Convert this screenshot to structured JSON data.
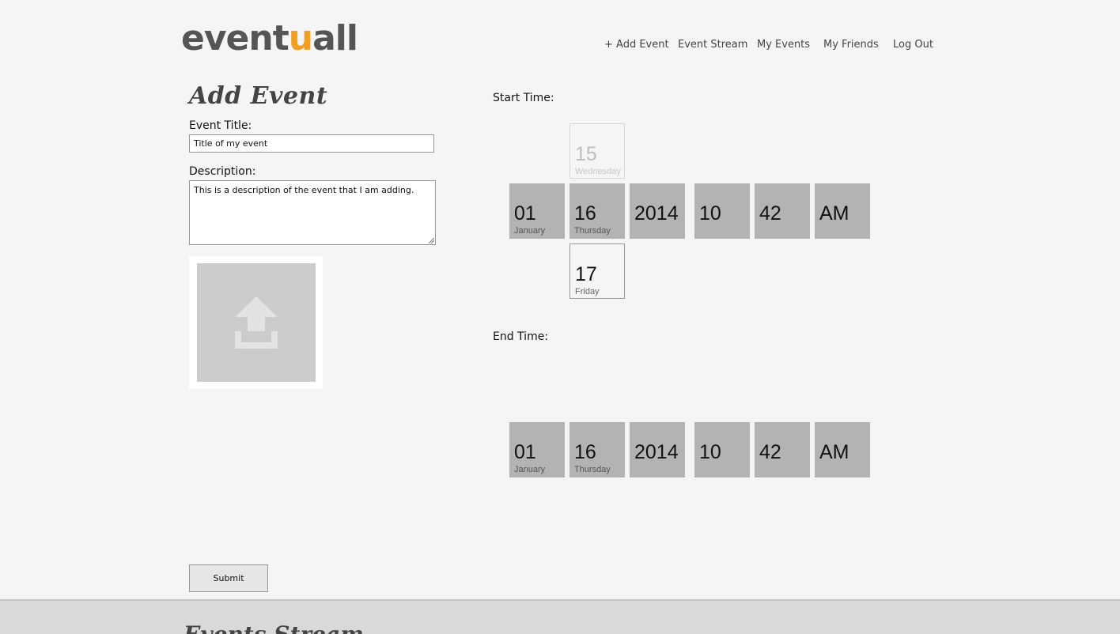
{
  "header": {
    "logo_main": "event",
    "logo_accent": "u",
    "logo_tail": "all",
    "nav": [
      "+ Add Event",
      "Event Stream",
      "My Events",
      "My Friends",
      "Log Out"
    ]
  },
  "form": {
    "title": "Add Event",
    "event_title_label": "Event Title:",
    "event_title_value": "Title of my event",
    "description_label": "Description:",
    "description_value": "This is a description of the event that I am adding.",
    "submit_label": "Submit"
  },
  "start_time": {
    "label": "Start Time:",
    "month": {
      "num": "01",
      "name": "January"
    },
    "day": {
      "num": "16",
      "name": "Thursday"
    },
    "day_prev": {
      "num": "15",
      "name": "Wednesday"
    },
    "day_next": {
      "num": "17",
      "name": "Friday"
    },
    "year": "2014",
    "hour": "10",
    "minute": "42",
    "ampm": "AM"
  },
  "end_time": {
    "label": "End Time:",
    "month": {
      "num": "01",
      "name": "January"
    },
    "day": {
      "num": "16",
      "name": "Thursday"
    },
    "year": "2014",
    "hour": "10",
    "minute": "42",
    "ampm": "AM"
  },
  "footer": {
    "heading": "Events Stream"
  },
  "colors": {
    "accent": "#f2a020",
    "tile": "#b3b3b3",
    "upload_placeholder": "#cccccc"
  },
  "icons": {
    "upload": "upload-icon"
  }
}
